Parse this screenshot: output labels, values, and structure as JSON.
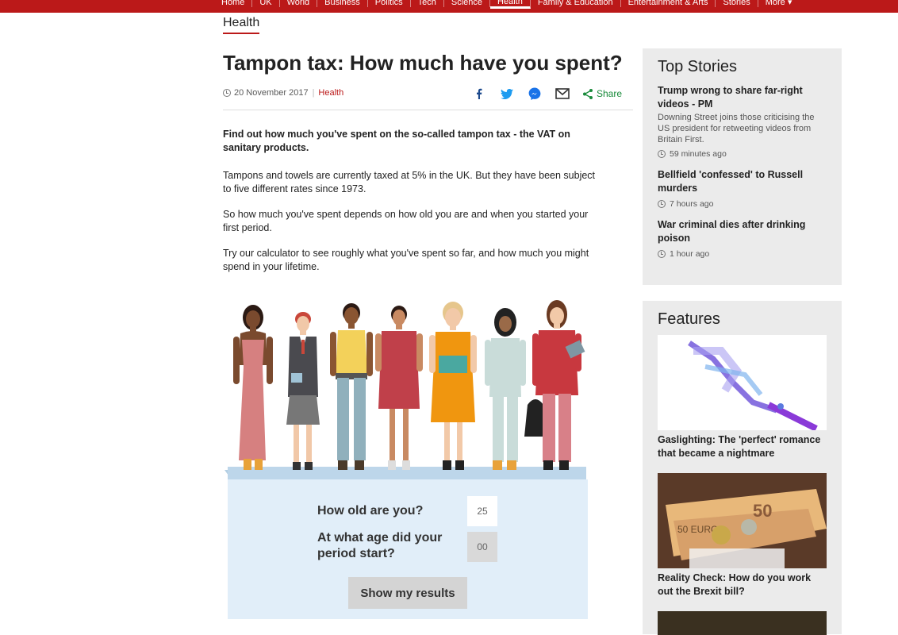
{
  "nav": {
    "items": [
      "Home",
      "UK",
      "World",
      "Business",
      "Politics",
      "Tech",
      "Science",
      "Health",
      "Family & Education",
      "Entertainment & Arts",
      "Stories",
      "More ▾"
    ],
    "active": "Health",
    "bg_color": "#bb1919"
  },
  "section": {
    "title": "Health"
  },
  "article": {
    "title": "Tampon tax: How much have you spent?",
    "date": "20 November 2017",
    "category": "Health",
    "share_label": "Share",
    "share_icons": [
      "facebook-icon",
      "twitter-icon",
      "messenger-icon",
      "email-icon",
      "share-icon"
    ],
    "intro": "Find out how much you've spent on the so-called tampon tax - the VAT on sanitary products.",
    "paragraphs": [
      "Tampons and towels are currently taxed at 5% in the UK. But they have been subject to five different rates since 1973.",
      "So how much you've spent depends on how old you are and when you started your first period.",
      "Try our calculator to see roughly what you've spent so far, and how much you might spend in your lifetime."
    ]
  },
  "calculator": {
    "q_age": "How old are you?",
    "age_value": "25",
    "q_period": "At what age did your period start?",
    "period_value": "00",
    "button": "Show my results"
  },
  "top_stories": {
    "heading": "Top Stories",
    "items": [
      {
        "title": "Trump wrong to share far-right videos - PM",
        "summary": "Downing Street joins those criticising the US president for retweeting videos from Britain First.",
        "time": "59 minutes ago"
      },
      {
        "title": "Bellfield 'confessed' to Russell murders",
        "summary": "",
        "time": "7 hours ago"
      },
      {
        "title": "War criminal dies after drinking poison",
        "summary": "",
        "time": "1 hour ago"
      }
    ]
  },
  "features": {
    "heading": "Features",
    "items": [
      {
        "caption": "Gaslighting: The 'perfect' romance that became a nightmare"
      },
      {
        "caption": "Reality Check: How do you work out the Brexit bill?"
      }
    ]
  }
}
